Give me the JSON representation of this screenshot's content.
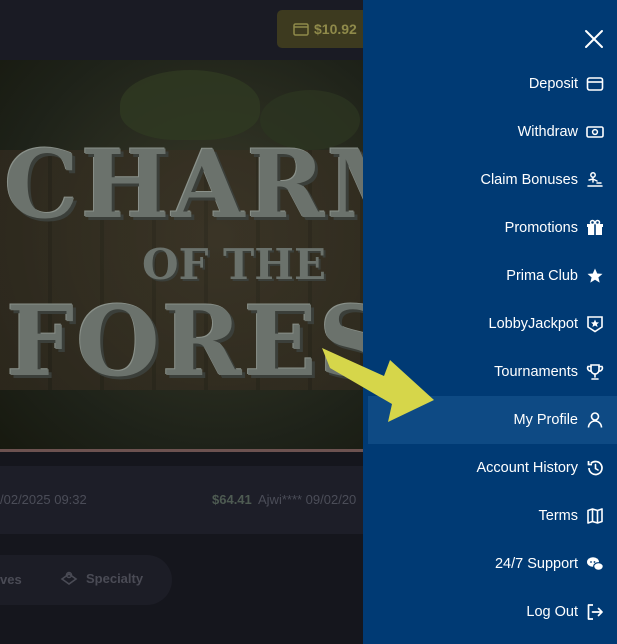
{
  "header": {
    "balance": "$10.92"
  },
  "banner": {
    "line1": "CHARM",
    "line2": "OF THE",
    "line3": "FORES"
  },
  "ticker": {
    "date_left": "/02/2025 09:32",
    "amount": "$64.41",
    "user": "Ajwi**** 09/02/20"
  },
  "tabs": {
    "left_partial": "ves",
    "specialty": "Specialty"
  },
  "menu": {
    "items": [
      {
        "label": "Deposit",
        "icon": "wallet-icon"
      },
      {
        "label": "Withdraw",
        "icon": "cash-icon"
      },
      {
        "label": "Claim Bonuses",
        "icon": "bonus-icon"
      },
      {
        "label": "Promotions",
        "icon": "gift-icon"
      },
      {
        "label": "Prima Club",
        "icon": "star-icon"
      },
      {
        "label": "LobbyJackpot",
        "icon": "jackpot-icon"
      },
      {
        "label": "Tournaments",
        "icon": "trophy-icon"
      },
      {
        "label": "My Profile",
        "icon": "user-icon",
        "active": true
      },
      {
        "label": "Account History",
        "icon": "history-icon"
      },
      {
        "label": "Terms",
        "icon": "map-icon"
      },
      {
        "label": "24/7 Support",
        "icon": "chat-icon"
      },
      {
        "label": "Log Out",
        "icon": "logout-icon"
      }
    ]
  },
  "colors": {
    "drawer_bg": "#003a74",
    "active_bg": "#0e4a84",
    "arrow": "#d6d64a"
  }
}
